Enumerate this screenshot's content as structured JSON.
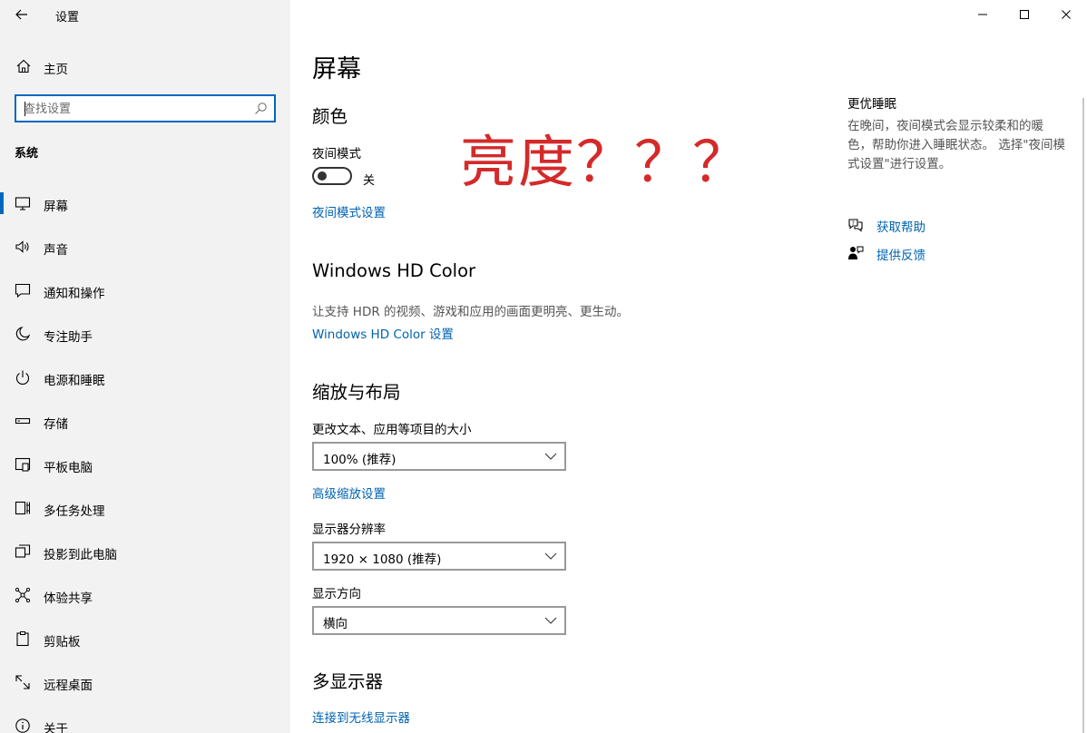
{
  "window": {
    "title": "设置",
    "controls": [
      "minimize",
      "maximize",
      "close"
    ]
  },
  "sidebar": {
    "home_label": "主页",
    "search_placeholder": "查找设置",
    "section_label": "系统",
    "items": [
      {
        "label": "屏幕",
        "icon": "monitor-icon",
        "active": true
      },
      {
        "label": "声音",
        "icon": "speaker-icon"
      },
      {
        "label": "通知和操作",
        "icon": "notification-icon"
      },
      {
        "label": "专注助手",
        "icon": "moon-icon"
      },
      {
        "label": "电源和睡眠",
        "icon": "power-icon"
      },
      {
        "label": "存储",
        "icon": "storage-icon"
      },
      {
        "label": "平板电脑",
        "icon": "tablet-icon"
      },
      {
        "label": "多任务处理",
        "icon": "multitask-icon"
      },
      {
        "label": "投影到此电脑",
        "icon": "project-icon"
      },
      {
        "label": "体验共享",
        "icon": "share-icon"
      },
      {
        "label": "剪贴板",
        "icon": "clipboard-icon"
      },
      {
        "label": "远程桌面",
        "icon": "remote-icon"
      },
      {
        "label": "关于",
        "icon": "info-icon"
      }
    ]
  },
  "main": {
    "title": "屏幕",
    "color": {
      "heading": "颜色",
      "night_mode_label": "夜间模式",
      "night_mode_state": "关",
      "night_mode_link": "夜间模式设置"
    },
    "hdr": {
      "heading": "Windows HD Color",
      "description": "让支持 HDR 的视频、游戏和应用的画面更明亮、更生动。",
      "link": "Windows HD Color 设置"
    },
    "scale": {
      "heading": "缩放与布局",
      "size_label": "更改文本、应用等项目的大小",
      "size_value": "100% (推荐)",
      "advanced_link": "高级缩放设置",
      "resolution_label": "显示器分辨率",
      "resolution_value": "1920 × 1080 (推荐)",
      "orientation_label": "显示方向",
      "orientation_value": "横向"
    },
    "multi": {
      "heading": "多显示器",
      "link": "连接到无线显示器"
    },
    "annotation": "亮度？？？"
  },
  "right_panel": {
    "title": "更优睡眠",
    "description": "在晚间，夜间模式会显示较柔和的暖色，帮助你进入睡眠状态。 选择\"夜间模式设置\"进行设置。",
    "help_link": "获取帮助",
    "feedback_link": "提供反馈"
  },
  "colors": {
    "accent": "#0067c0",
    "link": "#0063b1",
    "annotation": "#d42a2a",
    "sidebar_bg": "#f2f2f2"
  }
}
